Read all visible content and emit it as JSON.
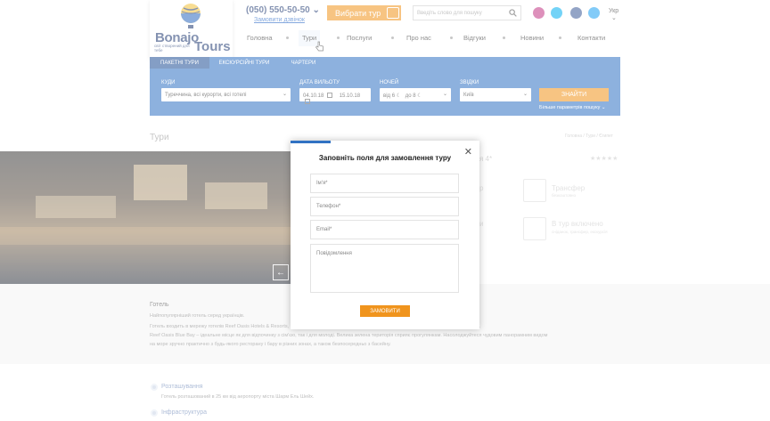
{
  "logo": {
    "line1": "Bonajo",
    "line2": "Tours",
    "sub": "світ створений для тебе"
  },
  "header": {
    "phone": "(050) 550-50-50",
    "callback": "Замовити дзвінок",
    "choose_tour": "Вибрати тур",
    "search_placeholder": "Введіть слово для пошуку",
    "lang": "Укр"
  },
  "nav": [
    "Головна",
    "Тури",
    "Послуги",
    "Про нас",
    "Відгуки",
    "Новини",
    "Контакти"
  ],
  "tabs": [
    "ПАКЕТНІ ТУРИ",
    "ЕКСКУРСІЙНІ ТУРИ",
    "ЧАРТЕРИ"
  ],
  "filters": {
    "where_label": "КУДИ",
    "where_value": "Туреччина, всі курорти, всі готелі",
    "date_label": "ДАТА ВИЛЬОТУ",
    "date_from": "04.10.18",
    "date_to": "15.10.18",
    "nights_label": "НОЧЕЙ",
    "nights_from": "від 6",
    "nights_to": "до 8",
    "from_label": "ЗВІДКИ",
    "from_value": "Київ",
    "find": "ЗНАЙТИ",
    "more": "Більше параметрів пошуку"
  },
  "page": {
    "title": "Тури",
    "breadcrumb": "Головна / Тури / Єгипет",
    "hotel_suffix": "я 4*",
    "stars": "★★★★★",
    "transfer": "Трансфер",
    "transfer_sub": "безкоштовно",
    "included": "В тур включено",
    "included_sub": "сніданок, трансфер, екскурсія",
    "hotel_heading": "Готель",
    "hotel_lead": "Найпопулярніший готель серед українців.",
    "hotel_text1": "Готель входить в мережу готелів Reef Oasis Hotels & Resorts, розташований в районі Шарм-Ель-Шейх, безпосередньо на березі Червоного моря.",
    "hotel_text2": "Reef Oasis Blue Bay – ідеальне місце як для відпочинку з сім'єю, так і для молоді. Велика зелена територія сприяє прогулянкам. Насолоджуйтеся чудовим панорамним видом",
    "hotel_text3": "на море зручно практично з будь-якого ресторану і бару в різних зонах, а також безпосередньо з басейну.",
    "location_h": "Розташування",
    "location_t": "Готель розташований в 25 км від аеропорту міста Шарм Ель Шейх.",
    "infra_h": "Інфраструктура"
  },
  "modal": {
    "title": "Заповніть поля для замовлення туру",
    "name": "Ім'я*",
    "phone": "Телефон*",
    "email": "Email*",
    "message": "Повідомлення",
    "submit": "ЗАМОВИТИ"
  },
  "colors": {
    "brand_blue": "#3172c3",
    "orange": "#f0941d",
    "navy": "#1f3a72"
  }
}
